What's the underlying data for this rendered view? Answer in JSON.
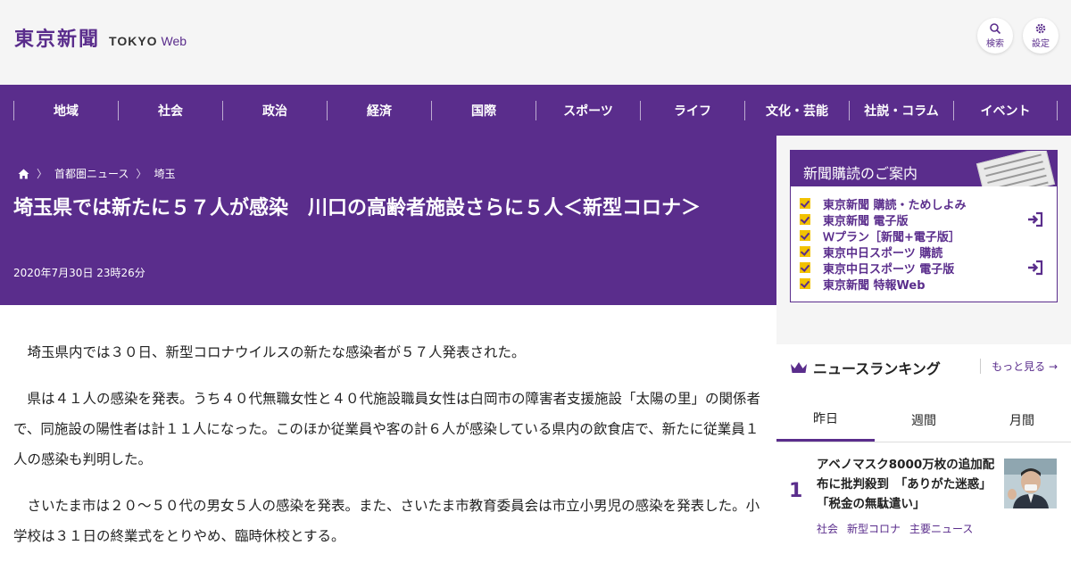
{
  "header": {
    "logo_kanji": "東京新聞",
    "logo_tokyo": "TOKYO",
    "logo_web": "Web",
    "search_label": "検索",
    "settings_label": "設定"
  },
  "nav": [
    "地域",
    "社会",
    "政治",
    "経済",
    "国際",
    "スポーツ",
    "ライフ",
    "文化・芸能",
    "社説・コラム",
    "イベント"
  ],
  "breadcrumb": {
    "home_icon": "home-icon",
    "items": [
      "首都圏ニュース",
      "埼玉"
    ]
  },
  "article": {
    "title": "埼玉県では新たに５７人が感染　川口の高齢者施設さらに５人＜新型コロナ＞",
    "date": "2020年7月30日 23時26分",
    "paragraphs": [
      "埼玉県内では３０日、新型コロナウイルスの新たな感染者が５７人発表された。",
      "県は４１人の感染を発表。うち４０代無職女性と４０代施設職員女性は白岡市の障害者支援施設「太陽の里」の関係者で、同施設の陽性者は計１１人になった。このほか従業員や客の計６人が感染している県内の飲食店で、新たに従業員１人の感染も判明した。",
      "さいたま市は２０～５０代の男女５人の感染を発表。また、さいたま市教育委員会は市立小男児の感染を発表した。小学校は３１日の終業式をとりやめ、臨時休校とする。"
    ]
  },
  "promo": {
    "title": "新聞購読のご案内",
    "items": [
      "東京新聞 購読・ためしよみ",
      "東京新聞 電子版",
      "Ｗプラン［新聞+電子版］",
      "東京中日スポーツ 購読",
      "東京中日スポーツ 電子版",
      "東京新聞 特報Web"
    ]
  },
  "ranking": {
    "title": "ニュースランキング",
    "more": "もっと見る",
    "tabs": [
      "昨日",
      "週間",
      "月間"
    ],
    "items": [
      {
        "rank": "1",
        "text": "アベノマスク8000万枚の追加配布に批判殺到　「ありがた迷惑」「税金の無駄遣い」",
        "tags": [
          "社会",
          "新型コロナ",
          "主要ニュース"
        ]
      }
    ]
  },
  "colors": {
    "brand": "#5a2d8c",
    "check": "#f2c200"
  }
}
